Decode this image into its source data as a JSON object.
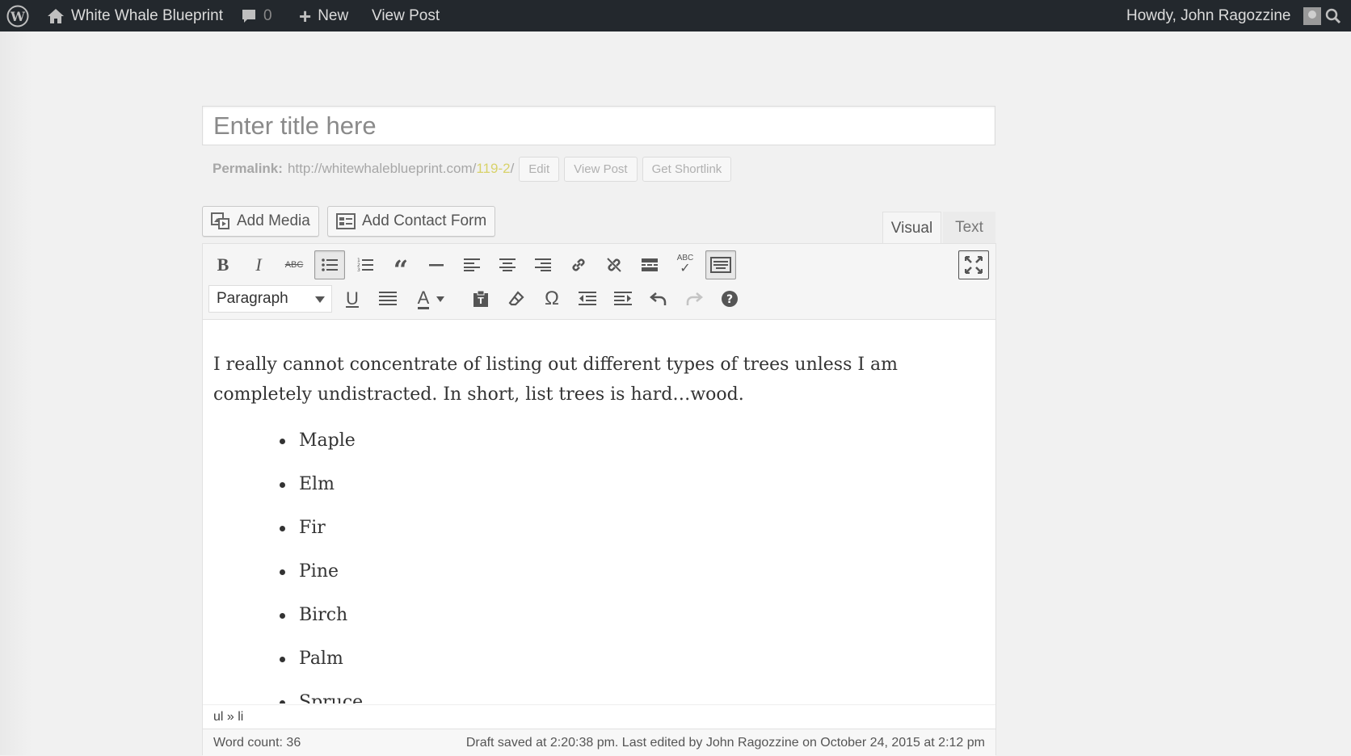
{
  "adminbar": {
    "site_name": "White Whale Blueprint",
    "comments_count": "0",
    "new_label": "New",
    "view_post_label": "View Post",
    "howdy": "Howdy, John Ragozzine"
  },
  "title": {
    "placeholder": "Enter title here",
    "value": ""
  },
  "permalink": {
    "label": "Permalink:",
    "base_url": "http://whitewhaleblueprint.com/",
    "slug": "119-2",
    "trailing": "/",
    "edit_label": "Edit",
    "view_post_label": "View Post",
    "shortlink_label": "Get Shortlink"
  },
  "media_buttons": {
    "add_media": "Add Media",
    "add_contact_form": "Add Contact Form"
  },
  "tabs": {
    "visual": "Visual",
    "text": "Text"
  },
  "toolbar": {
    "format_select": "Paragraph",
    "row1": [
      "bold",
      "italic",
      "strikethrough",
      "bulleted-list",
      "numbered-list",
      "blockquote",
      "horizontal-line",
      "align-left",
      "align-center",
      "align-right",
      "insert-link",
      "remove-link",
      "read-more",
      "spellcheck",
      "toolbar-toggle"
    ],
    "row2": [
      "underline",
      "justify",
      "text-color",
      "paste-as-text",
      "clear-formatting",
      "special-character",
      "outdent",
      "indent",
      "undo",
      "redo",
      "help"
    ],
    "spellcheck_text": "ABC"
  },
  "content": {
    "paragraph": "I really cannot concentrate of listing out different types of trees unless I am completely undistracted. In short, list trees is hard…wood.",
    "list": [
      "Maple",
      "Elm",
      "Fir",
      "Pine",
      "Birch",
      "Palm",
      "Spruce"
    ]
  },
  "path": "ul » li",
  "status": {
    "word_count": "Word count: 36",
    "draft": "Draft saved at 2:20:38 pm. Last edited by John Ragozzine on October 24, 2015 at 2:12 pm"
  }
}
